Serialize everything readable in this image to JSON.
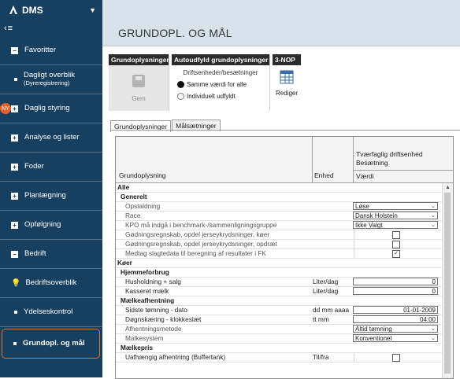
{
  "brand": {
    "name": "DMS"
  },
  "sidebar": {
    "items": [
      {
        "label": "Favoritter",
        "sub": "",
        "marker": "minus",
        "badge": ""
      },
      {
        "label": "Dagligt overblik",
        "sub": "(Dyreregistrering)",
        "marker": "dot",
        "badge": ""
      },
      {
        "label": "Daglig styring",
        "sub": "",
        "marker": "plus",
        "badge": "NY"
      },
      {
        "label": "Analyse og lister",
        "sub": "",
        "marker": "plus",
        "badge": ""
      },
      {
        "label": "Foder",
        "sub": "",
        "marker": "plus",
        "badge": ""
      },
      {
        "label": "Planlægning",
        "sub": "",
        "marker": "plus",
        "badge": ""
      },
      {
        "label": "Opfølgning",
        "sub": "",
        "marker": "plus",
        "badge": ""
      },
      {
        "label": "Bedrift",
        "sub": "",
        "marker": "minus",
        "badge": ""
      },
      {
        "label": "Bedriftsoverblik",
        "sub": "",
        "marker": "bulb",
        "badge": ""
      },
      {
        "label": "Ydelseskontrol",
        "sub": "",
        "marker": "dot",
        "badge": ""
      },
      {
        "label": "Grundopl. og mål",
        "sub": "",
        "marker": "dot",
        "badge": "",
        "active": true
      }
    ]
  },
  "page": {
    "title": "GRUNDOPL. OG MÅL"
  },
  "ribbon": {
    "group1": {
      "head": "Grundoplysninger",
      "button": "Gem"
    },
    "group2": {
      "head": "Autoudfyld grundoplysninger",
      "sub": "Driftsenheder/besætninger",
      "opt1": "Samme værdi for alle",
      "opt2": "Individuelt udfyldt"
    },
    "group3": {
      "head": "3-NOP",
      "button": "Rediger"
    }
  },
  "tabs": [
    "Grundoplysninger",
    "Målsætninger"
  ],
  "table": {
    "col_label": "Grundoplysning",
    "col_unit": "Enhed",
    "col_group1": "Tværfaglig driftsenhed",
    "col_group2": "Besætning",
    "col_value": "Værdi",
    "rows": [
      {
        "kind": "g0",
        "label": "Alle"
      },
      {
        "kind": "g1",
        "label": "Generelt"
      },
      {
        "kind": "item",
        "label": "Opstaldning",
        "unit": "",
        "control": "select",
        "value": "Løse"
      },
      {
        "kind": "item",
        "label": "Race",
        "unit": "",
        "control": "select",
        "value": "Dansk Holstein"
      },
      {
        "kind": "item",
        "label": "KPO må indgå i benchmark-/sammenligningsgruppe",
        "unit": "",
        "control": "select",
        "value": "Ikke Valgt"
      },
      {
        "kind": "item",
        "label": "Gødningsregnskab, opdel jerseykrydsninger, køer",
        "unit": "",
        "control": "check",
        "value": ""
      },
      {
        "kind": "item",
        "label": "Gødningsregnskab, opdel jerseykrydsninger, opdræt",
        "unit": "",
        "control": "check",
        "value": ""
      },
      {
        "kind": "item",
        "label": "Medtag slagtedata til beregning af resultater i FK",
        "unit": "",
        "control": "check",
        "value": "✓"
      },
      {
        "kind": "g0",
        "label": "Køer"
      },
      {
        "kind": "g1",
        "label": "Hjemmeforbrug"
      },
      {
        "kind": "item",
        "label": "Husholdning + salg",
        "unit": "Liter/dag",
        "control": "num",
        "value": "0"
      },
      {
        "kind": "item",
        "label": "Kasseret mælk",
        "unit": "Liter/dag",
        "control": "num",
        "value": "0"
      },
      {
        "kind": "g1",
        "label": "Mælkeafhentning"
      },
      {
        "kind": "item",
        "label": "Sidste tømning - dato",
        "unit": "dd mm aaaa",
        "control": "num",
        "value": "01-01-2009"
      },
      {
        "kind": "item",
        "label": "Døgnskæring - klokkeslæt",
        "unit": "tt mm",
        "control": "num",
        "value": "04:00"
      },
      {
        "kind": "item",
        "label": "Afhentningsmetode",
        "unit": "",
        "control": "select",
        "value": "Altid tømning"
      },
      {
        "kind": "item",
        "label": "Malkesystem",
        "unit": "",
        "control": "select",
        "value": "Konventionel"
      },
      {
        "kind": "g1",
        "label": "Mælkepris"
      },
      {
        "kind": "item",
        "label": "Uafhængig afhentning (Buffertank)",
        "unit": "Til/fra",
        "control": "check",
        "value": ""
      }
    ]
  },
  "icons": {
    "save": "save-icon",
    "grid": "grid-icon",
    "menu": "hamburger-icon",
    "back": "chevron-left-icon"
  },
  "colors": {
    "sidebar": "#173f5f",
    "active_border": "#e07a2e",
    "badge": "#e0632e",
    "topbar": "#d8e2ea"
  }
}
